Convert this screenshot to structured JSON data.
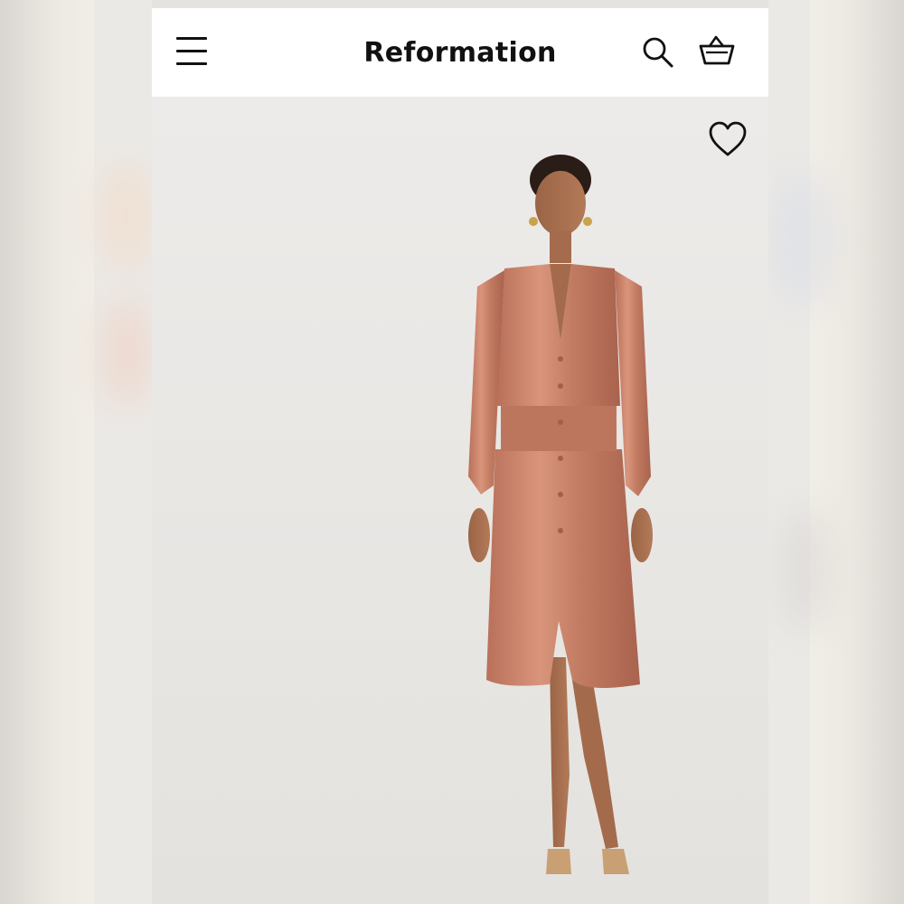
{
  "header": {
    "brand": "Reformation",
    "icons": [
      "menu-icon",
      "search-icon",
      "shopping-bag-icon"
    ]
  },
  "product": {
    "image": "model-wearing-satin-midi-dress",
    "wishlist_icon": "heart-icon"
  },
  "colors": {
    "header_bg": "#ffffff",
    "hero_bg": "#ecebe9",
    "dress": "#c47f67",
    "text": "#111111"
  }
}
